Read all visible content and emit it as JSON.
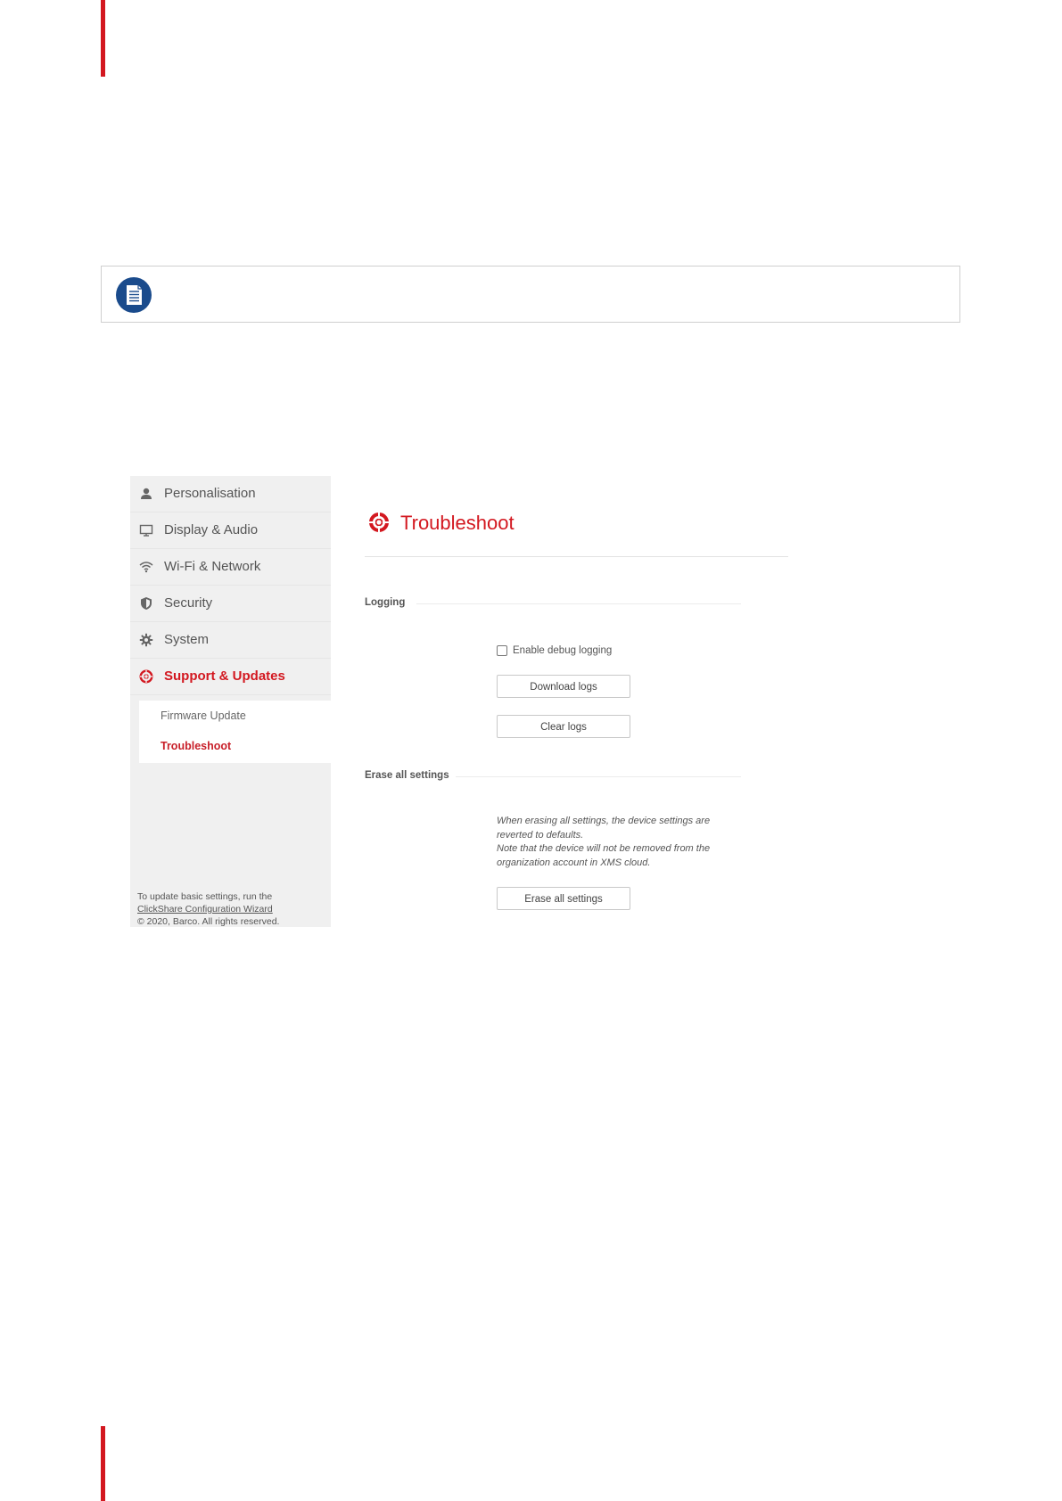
{
  "sidebar": {
    "items": [
      {
        "label": "Personalisation",
        "icon": "user-icon"
      },
      {
        "label": "Display & Audio",
        "icon": "monitor-icon"
      },
      {
        "label": "Wi-Fi & Network",
        "icon": "wifi-icon"
      },
      {
        "label": "Security",
        "icon": "shield-icon"
      },
      {
        "label": "System",
        "icon": "gear-icon"
      },
      {
        "label": "Support & Updates",
        "icon": "lifebuoy-icon",
        "active": true
      }
    ],
    "subitems": [
      {
        "label": "Firmware Update"
      },
      {
        "label": "Troubleshoot",
        "active": true
      }
    ],
    "footer": {
      "line1": "To update basic settings, run the",
      "link": "ClickShare Configuration Wizard",
      "copyright": "© 2020, Barco. All rights reserved."
    }
  },
  "main": {
    "title": "Troubleshoot",
    "logging": {
      "label": "Logging",
      "checkbox_label": "Enable debug logging",
      "checkbox_checked": false,
      "download_button": "Download logs",
      "clear_button": "Clear logs"
    },
    "erase": {
      "label": "Erase all settings",
      "description_1": "When erasing all settings, the device settings are reverted to defaults.",
      "description_2": "Note that the device will not be removed from the organization account in XMS cloud.",
      "button": "Erase all settings"
    }
  },
  "colors": {
    "accent": "#d31820",
    "note_icon": "#1a4b8c"
  }
}
